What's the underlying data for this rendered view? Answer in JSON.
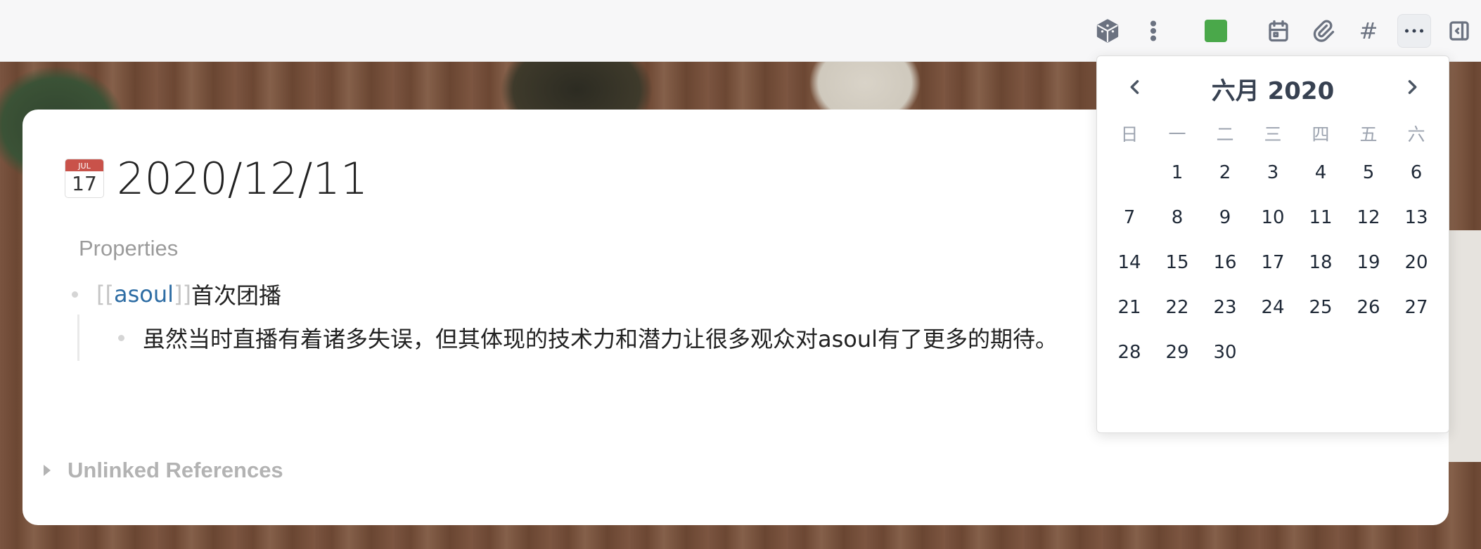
{
  "toolbar": {
    "icons": [
      "dice-icon",
      "more-vertical-icon",
      "color-swatch",
      "calendar-icon",
      "attachment-icon",
      "hashtag-icon",
      "more-horizontal-icon",
      "sidebar-toggle-icon"
    ],
    "swatch_color": "#4aa84a",
    "hash_label": "#"
  },
  "page": {
    "icon_month": "JUL",
    "icon_day": "17",
    "title": "2020/12/11",
    "properties_label": "Properties",
    "block1": {
      "bracket_open": "[[",
      "ref": "asoul",
      "bracket_close": "]]",
      "text": " 首次团播"
    },
    "block2_text": "虽然当时直播有着诸多失误，但其体现的技术力和潜力让很多观众对asoul有了更多的期待。",
    "unlinked_label": "Unlinked References"
  },
  "datepicker": {
    "title": "六月 2020",
    "weekdays": [
      "日",
      "一",
      "二",
      "三",
      "四",
      "五",
      "六"
    ],
    "days": [
      "",
      "1",
      "2",
      "3",
      "4",
      "5",
      "6",
      "7",
      "8",
      "9",
      "10",
      "11",
      "12",
      "13",
      "14",
      "15",
      "16",
      "17",
      "18",
      "19",
      "20",
      "21",
      "22",
      "23",
      "24",
      "25",
      "26",
      "27",
      "28",
      "29",
      "30"
    ]
  }
}
